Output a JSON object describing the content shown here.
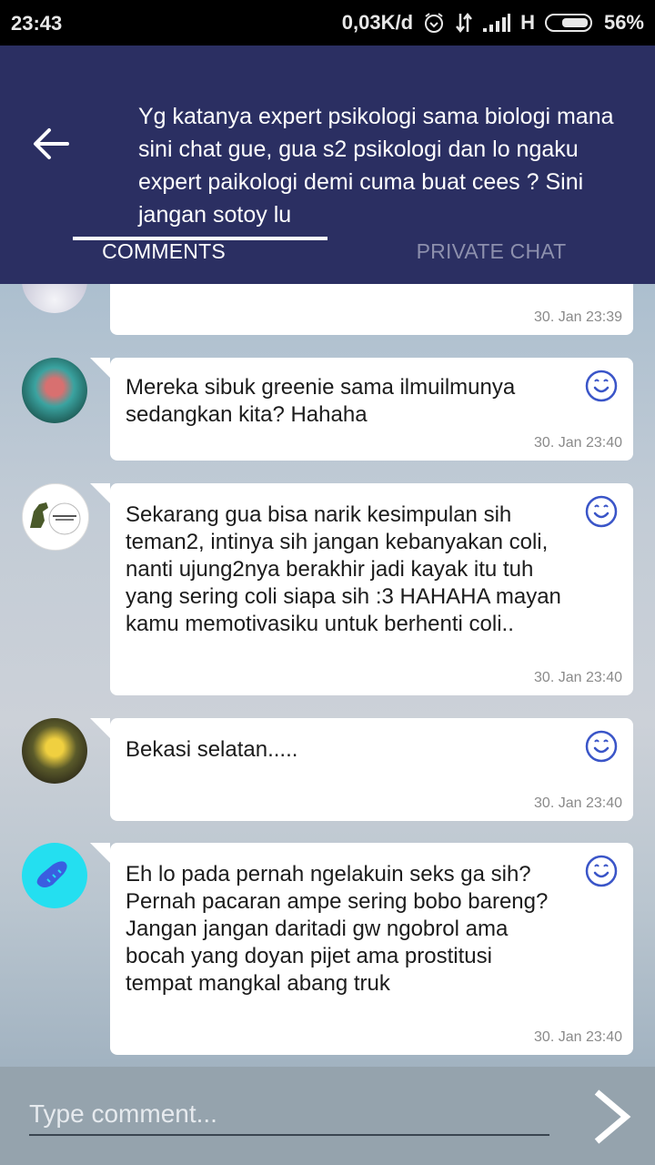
{
  "status_bar": {
    "time": "23:43",
    "network_speed": "0,03K/d",
    "network_type": "H",
    "battery": "56%",
    "icons": [
      "alarm-icon",
      "data-transfer-icon",
      "signal-icon",
      "battery-icon"
    ]
  },
  "header": {
    "back_icon": "arrow-left-icon",
    "title": "Yg katanya expert psikologi sama biologi mana sini chat gue, gua s2 psikologi dan lo ngaku expert paikologi demi cuma buat cees ? Sini jangan sotoy lu",
    "tabs": [
      {
        "label": "COMMENTS",
        "active": true
      },
      {
        "label": "PRIVATE CHAT",
        "active": false
      }
    ]
  },
  "comments": [
    {
      "text": "",
      "time": "30. Jan 23:39",
      "avatar": "avatar-white-feathers",
      "reaction_icon": null
    },
    {
      "text": "Mereka sibuk greenie sama ilmuilmunya sedangkan kita? Hahaha",
      "time": "30. Jan 23:40",
      "avatar": "avatar-photo-person",
      "reaction_icon": "smiley-icon"
    },
    {
      "text": "Sekarang gua bisa narik kesimpulan sih teman2, intinya sih jangan kebanyakan coli, nanti ujung2nya berakhir jadi kayak itu tuh yang sering coli siapa sih :3 HAHAHA mayan kamu memotivasiku untuk berhenti coli..",
      "time": "30. Jan 23:40",
      "avatar": "avatar-dinosaur",
      "reaction_icon": "smiley-icon"
    },
    {
      "text": "Bekasi selatan.....",
      "time": "30. Jan 23:40",
      "avatar": "avatar-photo-yellow",
      "reaction_icon": "smiley-icon"
    },
    {
      "text": "Eh lo pada pernah ngelakuin seks ga sih? Pernah pacaran ampe sering bobo bareng? Jangan jangan daritadi gw ngobrol ama bocah yang doyan pijet ama prostitusi tempat mangkal abang truk",
      "time": "30. Jan 23:40",
      "avatar": "avatar-bread-cyan",
      "reaction_icon": "smiley-icon"
    }
  ],
  "composer": {
    "placeholder": "Type comment...",
    "value": "",
    "send_icon": "chevron-right-icon"
  },
  "colors": {
    "header_bg": "#2b2f62",
    "accent": "#3a55c8",
    "inactive_tab": "#8d90ad",
    "composer_bg": "#95a3ad"
  }
}
